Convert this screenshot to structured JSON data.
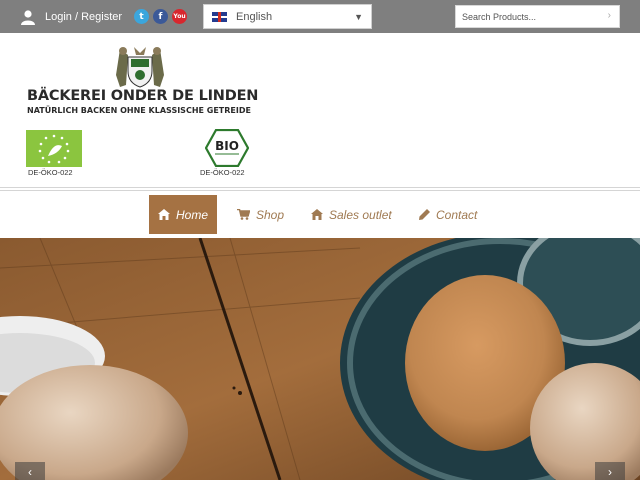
{
  "topbar": {
    "login_label": "Login / Register",
    "social": [
      "twitter-icon",
      "facebook-icon",
      "youtube-icon"
    ],
    "language": {
      "selected": "English",
      "flag": "uk-flag-icon"
    },
    "search": {
      "placeholder": "Search Products..."
    }
  },
  "header": {
    "brand": "BÄCKEREI ONDER DE LINDEN",
    "tagline": "NATÜRLICH BACKEN OHNE KLASSISCHE GETREIDE",
    "certificates": [
      {
        "code": "DE-ÖKO-022"
      },
      {
        "code": "DE-ÖKO-022"
      }
    ]
  },
  "nav": {
    "items": [
      {
        "label": "Home",
        "icon": "home-icon",
        "active": true
      },
      {
        "label": "Shop",
        "icon": "cart-icon"
      },
      {
        "label": "Sales outlet",
        "icon": "store-icon"
      },
      {
        "label": "Contact",
        "icon": "pencil-icon"
      }
    ]
  },
  "colors": {
    "topbar": "#7f7f7f",
    "accent": "#a57243",
    "nav_text": "#a07a52",
    "eu_green": "#8bc53f"
  }
}
